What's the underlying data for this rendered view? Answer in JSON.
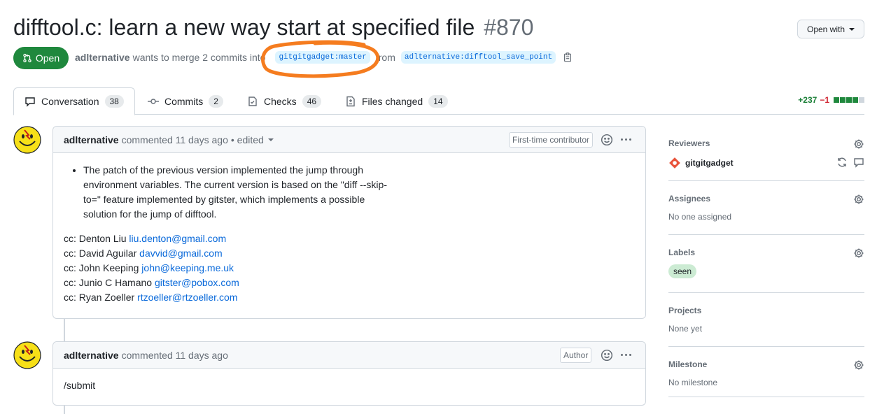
{
  "header": {
    "title": "difftool.c: learn a new way start at specified file",
    "number": "#870",
    "open_with": "Open with",
    "state": "Open",
    "author": "adlternative",
    "merge_text": "wants to merge 2 commits into",
    "base_branch": "gitgitgadget:master",
    "from_text": "from",
    "head_branch": "adlternative:difftool_save_point"
  },
  "tabs": [
    {
      "label": "Conversation",
      "count": "38"
    },
    {
      "label": "Commits",
      "count": "2"
    },
    {
      "label": "Checks",
      "count": "46"
    },
    {
      "label": "Files changed",
      "count": "14"
    }
  ],
  "diffstat": {
    "additions": "+237",
    "deletions": "−1"
  },
  "colors": {
    "open_green": "#1f883d",
    "link_blue": "#0969da",
    "annotation_orange": "#f57c1f",
    "label_green": "#ccebd3"
  },
  "comments": [
    {
      "author": "adlternative",
      "meta": "commented 11 days ago",
      "edited": "• edited",
      "badge": "First-time contributor",
      "bullet": "The patch of the previous version implemented the jump through environment variables. The current version is based on the \"diff --skip-to=\" feature implemented by gitster, which implements a possible solution for the jump of difftool.",
      "cc": [
        {
          "prefix": "cc: Denton Liu",
          "email": "liu.denton@gmail.com"
        },
        {
          "prefix": "cc: David Aguilar",
          "email": "davvid@gmail.com"
        },
        {
          "prefix": "cc: John Keeping",
          "email": "john@keeping.me.uk"
        },
        {
          "prefix": "cc: Junio C Hamano",
          "email": "gitster@pobox.com"
        },
        {
          "prefix": "cc: Ryan Zoeller",
          "email": "rtzoeller@rtzoeller.com"
        }
      ]
    },
    {
      "author": "adlternative",
      "meta": "commented 11 days ago",
      "badge": "Author",
      "body": "/submit"
    }
  ],
  "sidebar": {
    "reviewers": {
      "heading": "Reviewers",
      "name": "gitgitgadget"
    },
    "assignees": {
      "heading": "Assignees",
      "value": "No one assigned"
    },
    "labels": {
      "heading": "Labels",
      "value": "seen"
    },
    "projects": {
      "heading": "Projects",
      "value": "None yet"
    },
    "milestone": {
      "heading": "Milestone",
      "value": "No milestone"
    }
  }
}
